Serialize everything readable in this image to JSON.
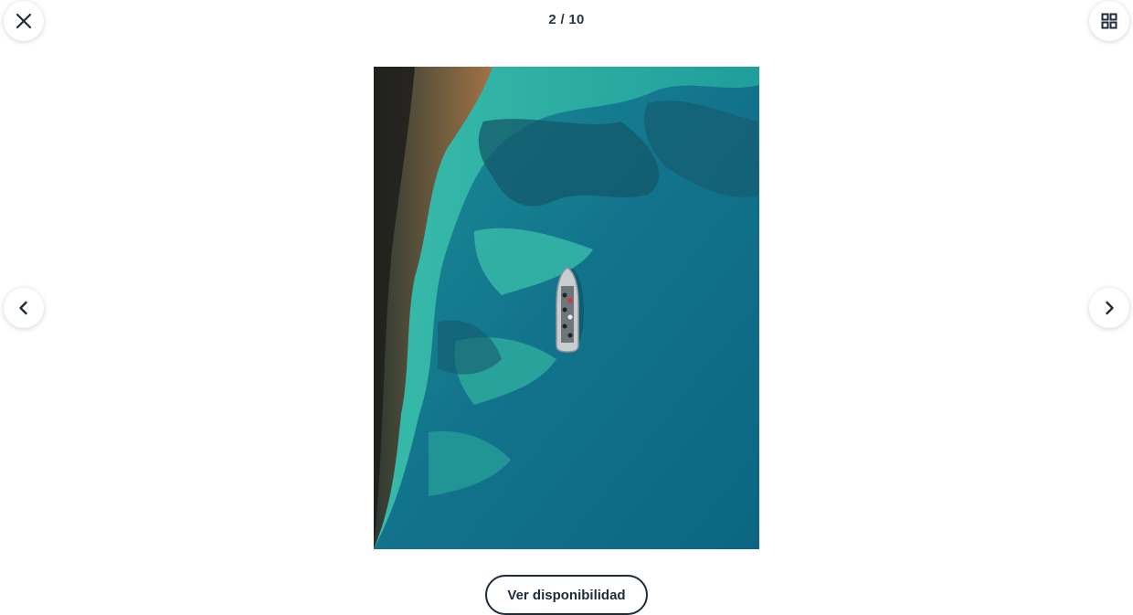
{
  "gallery": {
    "counter": "2 / 10",
    "current_index": 2,
    "total": 10
  },
  "controls": {
    "close_icon": "close-icon",
    "grid_icon": "grid-view-icon",
    "prev_icon": "chevron-left-icon",
    "next_icon": "chevron-right-icon"
  },
  "cta": {
    "label": "Ver disponibilidad"
  },
  "colors": {
    "text": "#1d2b3a",
    "water_deep": "#0f6f8a",
    "water_shallow": "#2fb7a8"
  }
}
